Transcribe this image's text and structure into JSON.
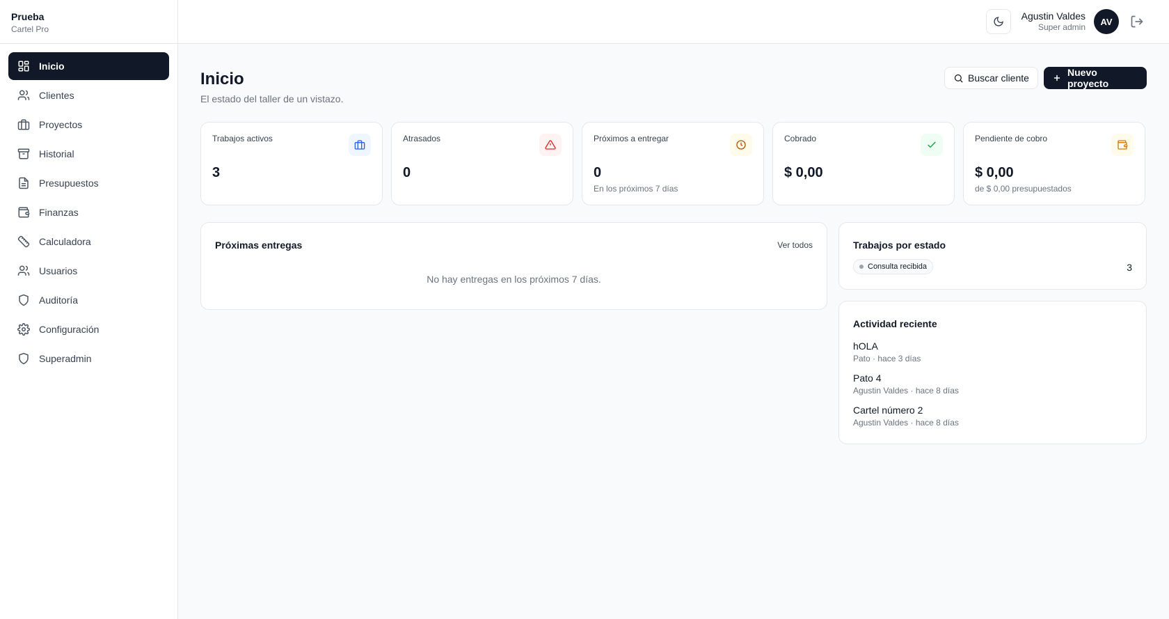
{
  "brand": {
    "name": "Prueba",
    "subtitle": "Cartel Pro"
  },
  "sidebar": {
    "items": [
      {
        "label": "Inicio",
        "icon": "grid-icon",
        "active": true
      },
      {
        "label": "Clientes",
        "icon": "users-icon"
      },
      {
        "label": "Proyectos",
        "icon": "briefcase-icon"
      },
      {
        "label": "Historial",
        "icon": "archive-icon"
      },
      {
        "label": "Presupuestos",
        "icon": "file-text-icon"
      },
      {
        "label": "Finanzas",
        "icon": "wallet-icon"
      },
      {
        "label": "Calculadora",
        "icon": "ruler-icon"
      },
      {
        "label": "Usuarios",
        "icon": "users-icon"
      },
      {
        "label": "Auditoría",
        "icon": "shield-icon"
      },
      {
        "label": "Configuración",
        "icon": "gear-icon"
      },
      {
        "label": "Superadmin",
        "icon": "shield-icon"
      }
    ]
  },
  "header": {
    "theme_icon": "moon-icon",
    "user_name": "Agustin Valdes",
    "user_role": "Super admin",
    "avatar_initials": "AV",
    "logout_icon": "logout-icon"
  },
  "page": {
    "title": "Inicio",
    "subtitle": "El estado del taller de un vistazo.",
    "search_button": "Buscar cliente",
    "new_project_button": "Nuevo proyecto"
  },
  "stats": {
    "active": {
      "label": "Trabajos activos",
      "value": "3",
      "icon": "briefcase-icon",
      "color": "#2563eb",
      "bg": "#eff6ff"
    },
    "late": {
      "label": "Atrasados",
      "value": "0",
      "icon": "alert-triangle-icon",
      "color": "#dc2626",
      "bg": "#fef2f2"
    },
    "upcoming": {
      "label": "Próximos a entregar",
      "value": "0",
      "note": "En los próximos 7 días",
      "icon": "clock-icon",
      "color": "#b45309",
      "bg": "#fffbeb"
    },
    "collected": {
      "label": "Cobrado",
      "value": "$ 0,00",
      "icon": "check-icon",
      "color": "#16a34a",
      "bg": "#f0fdf4"
    },
    "pending": {
      "label": "Pendiente de cobro",
      "value": "$ 0,00",
      "note": "de $ 0,00 presupuestados",
      "icon": "wallet-icon",
      "color": "#d97706",
      "bg": "#fffbeb"
    }
  },
  "deliveries": {
    "title": "Próximas entregas",
    "view_all": "Ver todos",
    "empty": "No hay entregas en los próximos 7 días."
  },
  "by_status": {
    "title": "Trabajos por estado",
    "status_label": "Consulta recibida",
    "count": "3"
  },
  "activity": {
    "title": "Actividad reciente",
    "items": [
      {
        "title": "hOLA",
        "meta": "Pato · hace 3 días"
      },
      {
        "title": "Pato 4",
        "meta": "Agustin Valdes · hace 8 días"
      },
      {
        "title": "Cartel número 2",
        "meta": "Agustin Valdes · hace 8 días"
      }
    ]
  }
}
